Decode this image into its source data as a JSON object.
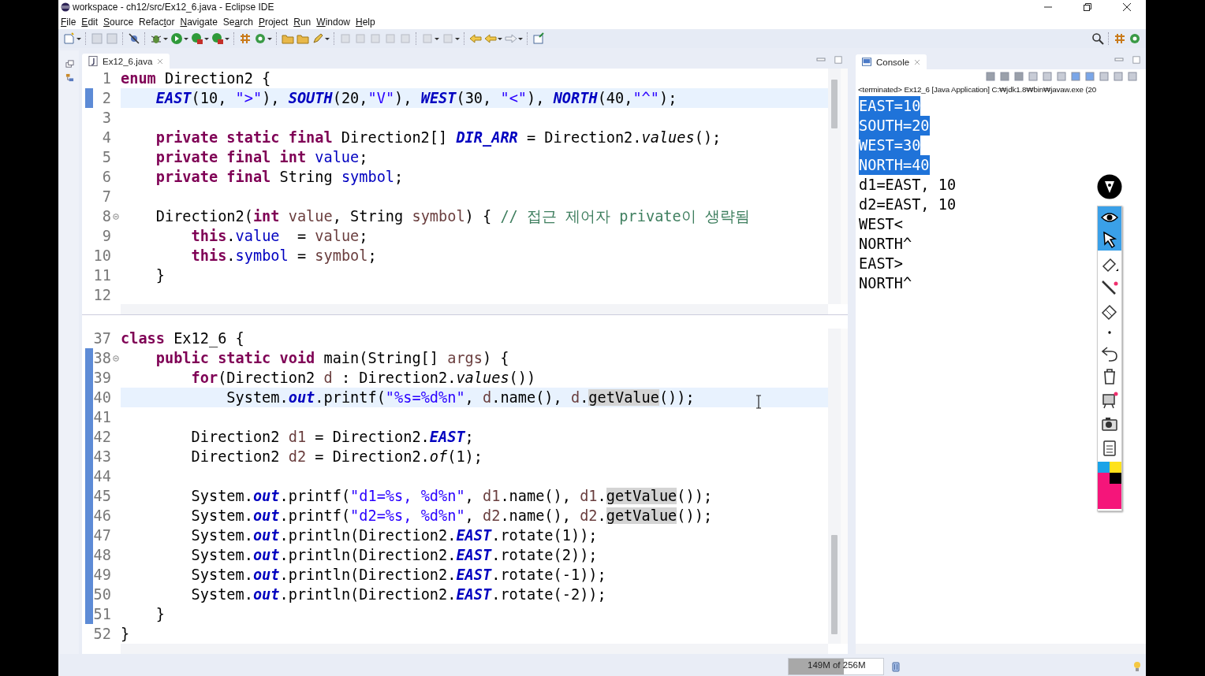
{
  "window": {
    "title": "workspace - ch12/src/Ex12_6.java - Eclipse IDE"
  },
  "menu": [
    {
      "key": "F",
      "post": "ile"
    },
    {
      "key": "E",
      "post": "dit"
    },
    {
      "key": "S",
      "post": "ource"
    },
    {
      "pre": "Refac",
      "key": "t",
      "post": "or"
    },
    {
      "key": "N",
      "post": "avigate"
    },
    {
      "pre": "Se",
      "key": "a",
      "post": "rch"
    },
    {
      "key": "P",
      "post": "roject"
    },
    {
      "key": "R",
      "post": "un"
    },
    {
      "key": "W",
      "post": "indow"
    },
    {
      "key": "H",
      "post": "elp"
    }
  ],
  "editor": {
    "tab": {
      "label": "Ex12_6.java",
      "selected": true
    },
    "panes": [
      {
        "lines": [
          {
            "n": "1",
            "current": false,
            "changed": false,
            "fold": false,
            "t": [
              {
                "kind": "k",
                "text": "enum"
              },
              {
                "kind": "p",
                "text": " Direction2 {"
              }
            ]
          },
          {
            "n": "2",
            "current": true,
            "changed": true,
            "fold": false,
            "t": [
              {
                "kind": "c",
                "text": "    EAST"
              },
              {
                "kind": "p",
                "text": "(10, "
              },
              {
                "kind": "s",
                "text": "\">\""
              },
              {
                "kind": "p",
                "text": "), "
              },
              {
                "kind": "c",
                "text": "SOUTH"
              },
              {
                "kind": "p",
                "text": "(20,"
              },
              {
                "kind": "s",
                "text": "\"V\""
              },
              {
                "kind": "p",
                "text": "), "
              },
              {
                "kind": "c",
                "text": "WEST"
              },
              {
                "kind": "p",
                "text": "(30, "
              },
              {
                "kind": "s",
                "text": "\"<\""
              },
              {
                "kind": "p",
                "text": "), "
              },
              {
                "kind": "c",
                "text": "NORTH"
              },
              {
                "kind": "p",
                "text": "(40,"
              },
              {
                "kind": "s",
                "text": "\"^\""
              },
              {
                "kind": "p",
                "text": ");"
              }
            ]
          },
          {
            "n": "3",
            "current": false,
            "changed": false,
            "fold": false
          },
          {
            "n": "4",
            "current": false,
            "changed": false,
            "fold": false,
            "t": [
              {
                "kind": "k",
                "text": "    private static final"
              },
              {
                "kind": "p",
                "text": " Direction2[] "
              },
              {
                "kind": "c",
                "text": "DIR_ARR"
              },
              {
                "kind": "p",
                "text": " = Direction2."
              },
              {
                "kind": "m",
                "text": "values"
              },
              {
                "kind": "p",
                "text": "();"
              }
            ]
          },
          {
            "n": "5",
            "current": false,
            "changed": false,
            "fold": false,
            "t": [
              {
                "kind": "k",
                "text": "    private final int"
              },
              {
                "kind": "v",
                "text": " value"
              },
              {
                "kind": "p",
                "text": ";"
              }
            ]
          },
          {
            "n": "6",
            "current": false,
            "changed": false,
            "fold": false,
            "t": [
              {
                "kind": "k",
                "text": "    private final"
              },
              {
                "kind": "p",
                "text": " String "
              },
              {
                "kind": "v",
                "text": "symbol"
              },
              {
                "kind": "p",
                "text": ";"
              }
            ]
          },
          {
            "n": "7",
            "current": false,
            "changed": false,
            "fold": false
          },
          {
            "n": "8",
            "current": false,
            "changed": false,
            "fold": true,
            "t": [
              {
                "kind": "p",
                "text": "    Direction2("
              },
              {
                "kind": "k",
                "text": "int"
              },
              {
                "kind": "l",
                "text": " value"
              },
              {
                "kind": "p",
                "text": ", String "
              },
              {
                "kind": "l",
                "text": "symbol"
              },
              {
                "kind": "p",
                "text": ") { "
              },
              {
                "kind": "o",
                "text": "// 접근 제어자 private이 생략됨"
              }
            ]
          },
          {
            "n": "9",
            "current": false,
            "changed": false,
            "fold": false,
            "t": [
              {
                "kind": "k",
                "text": "        this"
              },
              {
                "kind": "p",
                "text": "."
              },
              {
                "kind": "v",
                "text": "value"
              },
              {
                "kind": "p",
                "text": "  = "
              },
              {
                "kind": "l",
                "text": "value"
              },
              {
                "kind": "p",
                "text": ";"
              }
            ]
          },
          {
            "n": "10",
            "current": false,
            "changed": false,
            "fold": false,
            "t": [
              {
                "kind": "k",
                "text": "        this"
              },
              {
                "kind": "p",
                "text": "."
              },
              {
                "kind": "v",
                "text": "symbol"
              },
              {
                "kind": "p",
                "text": " = "
              },
              {
                "kind": "l",
                "text": "symbol"
              },
              {
                "kind": "p",
                "text": ";"
              }
            ]
          },
          {
            "n": "11",
            "current": false,
            "changed": false,
            "fold": false,
            "t": [
              {
                "kind": "p",
                "text": "    }"
              }
            ]
          },
          {
            "n": "12",
            "current": false,
            "changed": false,
            "fold": false
          }
        ]
      },
      {
        "lines": [
          {
            "n": "37",
            "current": false,
            "changed": false,
            "fold": false,
            "t": [
              {
                "kind": "k",
                "text": "class"
              },
              {
                "kind": "p",
                "text": " Ex12_6 {"
              }
            ]
          },
          {
            "n": "38",
            "current": false,
            "changed": true,
            "fold": true,
            "t": [
              {
                "kind": "k",
                "text": "    public static void"
              },
              {
                "kind": "p",
                "text": " main(String[] "
              },
              {
                "kind": "l",
                "text": "args"
              },
              {
                "kind": "p",
                "text": ") {"
              }
            ]
          },
          {
            "n": "39",
            "current": false,
            "changed": true,
            "fold": false,
            "t": [
              {
                "kind": "k",
                "text": "        for"
              },
              {
                "kind": "p",
                "text": "(Direction2 "
              },
              {
                "kind": "l",
                "text": "d"
              },
              {
                "kind": "p",
                "text": " : Direction2."
              },
              {
                "kind": "m",
                "text": "values"
              },
              {
                "kind": "p",
                "text": "())"
              }
            ]
          },
          {
            "n": "40",
            "current": true,
            "changed": true,
            "fold": false,
            "t": [
              {
                "kind": "p",
                "text": "            System."
              },
              {
                "kind": "c",
                "text": "out"
              },
              {
                "kind": "p",
                "text": ".printf("
              },
              {
                "kind": "s",
                "text": "\"%s=%d%n\""
              },
              {
                "kind": "p",
                "text": ", "
              },
              {
                "kind": "l",
                "text": "d"
              },
              {
                "kind": "p",
                "text": ".name(), "
              },
              {
                "kind": "l",
                "text": "d"
              },
              {
                "kind": "p",
                "text": "."
              },
              {
                "kind": "h",
                "text": "getValue"
              },
              {
                "kind": "p",
                "text": "());"
              }
            ]
          },
          {
            "n": "41",
            "current": false,
            "changed": true,
            "fold": false
          },
          {
            "n": "42",
            "current": false,
            "changed": true,
            "fold": false,
            "t": [
              {
                "kind": "p",
                "text": "        Direction2 "
              },
              {
                "kind": "l",
                "text": "d1"
              },
              {
                "kind": "p",
                "text": " = Direction2."
              },
              {
                "kind": "c",
                "text": "EAST"
              },
              {
                "kind": "p",
                "text": ";"
              }
            ]
          },
          {
            "n": "43",
            "current": false,
            "changed": true,
            "fold": false,
            "t": [
              {
                "kind": "p",
                "text": "        Direction2 "
              },
              {
                "kind": "l",
                "text": "d2"
              },
              {
                "kind": "p",
                "text": " = Direction2."
              },
              {
                "kind": "m",
                "text": "of"
              },
              {
                "kind": "p",
                "text": "(1);"
              }
            ]
          },
          {
            "n": "44",
            "current": false,
            "changed": true,
            "fold": false
          },
          {
            "n": "45",
            "current": false,
            "changed": true,
            "fold": false,
            "t": [
              {
                "kind": "p",
                "text": "        System."
              },
              {
                "kind": "c",
                "text": "out"
              },
              {
                "kind": "p",
                "text": ".printf("
              },
              {
                "kind": "s",
                "text": "\"d1=%s, %d%n\""
              },
              {
                "kind": "p",
                "text": ", "
              },
              {
                "kind": "l",
                "text": "d1"
              },
              {
                "kind": "p",
                "text": ".name(), "
              },
              {
                "kind": "l",
                "text": "d1"
              },
              {
                "kind": "p",
                "text": "."
              },
              {
                "kind": "h",
                "text": "getValue"
              },
              {
                "kind": "p",
                "text": "());"
              }
            ]
          },
          {
            "n": "46",
            "current": false,
            "changed": true,
            "fold": false,
            "t": [
              {
                "kind": "p",
                "text": "        System."
              },
              {
                "kind": "c",
                "text": "out"
              },
              {
                "kind": "p",
                "text": ".printf("
              },
              {
                "kind": "s",
                "text": "\"d2=%s, %d%n\""
              },
              {
                "kind": "p",
                "text": ", "
              },
              {
                "kind": "l",
                "text": "d2"
              },
              {
                "kind": "p",
                "text": ".name(), "
              },
              {
                "kind": "l",
                "text": "d2"
              },
              {
                "kind": "p",
                "text": "."
              },
              {
                "kind": "h",
                "text": "getValue"
              },
              {
                "kind": "p",
                "text": "());"
              }
            ]
          },
          {
            "n": "47",
            "current": false,
            "changed": true,
            "fold": false,
            "t": [
              {
                "kind": "p",
                "text": "        System."
              },
              {
                "kind": "c",
                "text": "out"
              },
              {
                "kind": "p",
                "text": ".println(Direction2."
              },
              {
                "kind": "c",
                "text": "EAST"
              },
              {
                "kind": "p",
                "text": ".rotate(1));"
              }
            ]
          },
          {
            "n": "48",
            "current": false,
            "changed": true,
            "fold": false,
            "t": [
              {
                "kind": "p",
                "text": "        System."
              },
              {
                "kind": "c",
                "text": "out"
              },
              {
                "kind": "p",
                "text": ".println(Direction2."
              },
              {
                "kind": "c",
                "text": "EAST"
              },
              {
                "kind": "p",
                "text": ".rotate(2));"
              }
            ]
          },
          {
            "n": "49",
            "current": false,
            "changed": true,
            "fold": false,
            "t": [
              {
                "kind": "p",
                "text": "        System."
              },
              {
                "kind": "c",
                "text": "out"
              },
              {
                "kind": "p",
                "text": ".println(Direction2."
              },
              {
                "kind": "c",
                "text": "EAST"
              },
              {
                "kind": "p",
                "text": ".rotate(-1));"
              }
            ]
          },
          {
            "n": "50",
            "current": false,
            "changed": true,
            "fold": false,
            "t": [
              {
                "kind": "p",
                "text": "        System."
              },
              {
                "kind": "c",
                "text": "out"
              },
              {
                "kind": "p",
                "text": ".println(Direction2."
              },
              {
                "kind": "c",
                "text": "EAST"
              },
              {
                "kind": "p",
                "text": ".rotate(-2));"
              }
            ]
          },
          {
            "n": "51",
            "current": false,
            "changed": true,
            "fold": false,
            "t": [
              {
                "kind": "p",
                "text": "    }"
              }
            ]
          },
          {
            "n": "52",
            "current": false,
            "changed": false,
            "fold": false,
            "t": [
              {
                "kind": "p",
                "text": "}"
              }
            ]
          }
        ]
      }
    ]
  },
  "console": {
    "tab": {
      "label": "Console",
      "selected": true
    },
    "info": "<terminated> Ex12_6 [Java Application] C:₩jdk1.8₩bin₩javaw.exe (20",
    "lines": [
      {
        "text": "EAST=10",
        "selected": true
      },
      {
        "text": "SOUTH=20",
        "selected": true
      },
      {
        "text": "WEST=30",
        "selected": true
      },
      {
        "text": "NORTH=40",
        "selected": true
      },
      {
        "text": "d1=EAST, 10",
        "selected": false
      },
      {
        "text": "d2=EAST, 10",
        "selected": false
      },
      {
        "text": "WEST<",
        "selected": false
      },
      {
        "text": "NORTH^",
        "selected": false
      },
      {
        "text": "EAST>",
        "selected": false
      },
      {
        "text": "NORTH^",
        "selected": false
      }
    ]
  },
  "status_bar": {
    "memory": {
      "text": "149M of 256M",
      "level": 0.58
    }
  }
}
